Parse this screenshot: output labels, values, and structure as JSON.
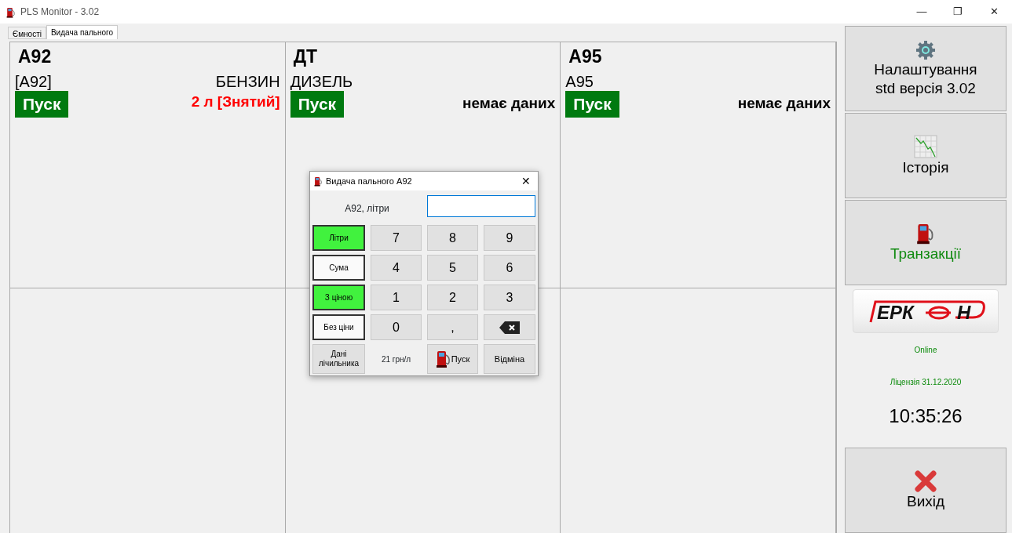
{
  "window": {
    "title": "PLS Monitor - 3.02",
    "controls": [
      "—",
      "❐",
      "✕"
    ]
  },
  "tabs": [
    {
      "label": "Ємності",
      "selected": false
    },
    {
      "label": "Видача пального",
      "selected": true
    }
  ],
  "pumps": [
    {
      "name": "А92",
      "product_code": "[А92]",
      "product": "БЕНЗИН",
      "start": "Пуск",
      "status": "2 л [Знятий]",
      "alert": true
    },
    {
      "name": "ДТ",
      "product_code": "ДИЗЕЛЬ",
      "start": "Пуск",
      "status": "немає даних",
      "alert": false
    },
    {
      "name": "А95",
      "product_code": "А95",
      "start": "Пуск",
      "status": "немає даних",
      "alert": false
    }
  ],
  "dialog": {
    "title": "Видача пального А92",
    "close": "✕",
    "field_label": "А92, літри",
    "modes": [
      {
        "label": "Літри",
        "selected": true
      },
      {
        "label": "Сума",
        "selected": false
      },
      {
        "label": "З ціною",
        "selected": true
      },
      {
        "label": "Без ціни",
        "selected": false
      }
    ],
    "keys": [
      {
        "label": "7",
        "kind": "digit"
      },
      {
        "label": "8",
        "kind": "digit"
      },
      {
        "label": "9",
        "kind": "digit"
      },
      {
        "label": "4",
        "kind": "digit"
      },
      {
        "label": "5",
        "kind": "digit"
      },
      {
        "label": "6",
        "kind": "digit"
      },
      {
        "label": "1",
        "kind": "digit"
      },
      {
        "label": "2",
        "kind": "digit"
      },
      {
        "label": "3",
        "kind": "digit"
      },
      {
        "label": "0",
        "kind": "digit"
      },
      {
        "label": ",",
        "kind": "digit"
      },
      {
        "kind": "backspace"
      }
    ],
    "meter_button": "Дані лічильника",
    "price": "21 грн/л",
    "start": "Пуск",
    "cancel": "Відміна"
  },
  "sidebar": {
    "settings": [
      "Налаштування",
      "std версія 3.02"
    ],
    "history": "Історія",
    "transactions": "Транзакції",
    "logo": [
      "ЕРК",
      "Н"
    ],
    "connection": "Online",
    "license": "Ліцензія 31.12.2020",
    "time": "10:35:26",
    "exit": "Вихід"
  }
}
